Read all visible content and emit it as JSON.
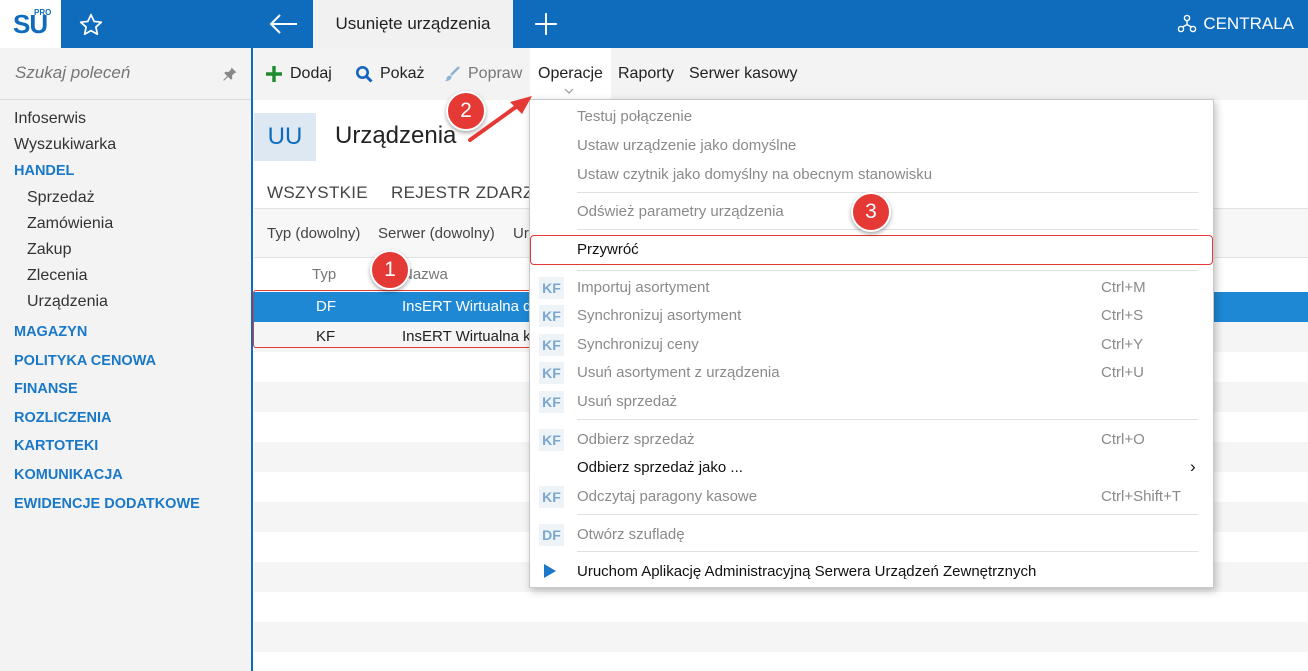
{
  "topbar": {
    "logo_text": "SU",
    "logo_pro": "PRO",
    "active_tab": "Usunięte urządzenia",
    "centrala": "CENTRALA",
    "accent_color": "#0f6cbd",
    "icons": [
      "star-icon",
      "back-arrow-icon",
      "plus-icon",
      "network-icon"
    ]
  },
  "sidebar": {
    "search_placeholder": "Szukaj poleceń",
    "items": [
      "Infoserwis",
      "Wyszukiwarka"
    ],
    "handel": {
      "label": "HANDEL",
      "children": [
        "Sprzedaż",
        "Zamówienia",
        "Zakup",
        "Zlecenia",
        "Urządzenia"
      ]
    },
    "sections": [
      "MAGAZYN",
      "POLITYKA CENOWA",
      "FINANSE",
      "ROZLICZENIA",
      "KARTOTEKI",
      "KOMUNIKACJA",
      "EWIDENCJE DODATKOWE"
    ]
  },
  "toolbar": {
    "add": "Dodaj",
    "show": "Pokaż",
    "edit": "Popraw",
    "operations": "Operacje",
    "reports": "Raporty",
    "cash_server": "Serwer kasowy"
  },
  "main": {
    "badge": "UU",
    "title": "Urządzenia",
    "subtabs": [
      "WSZYSTKIE",
      "REJESTR ZDARZE"
    ],
    "filters": [
      "Typ (dowolny)",
      "Serwer (dowolny)",
      "Ur"
    ],
    "columns": {
      "type": "Typ",
      "name": "Nazwa"
    },
    "rows": [
      {
        "type": "DF",
        "name": "InsERT Wirtualna d"
      },
      {
        "type": "KF",
        "name": "InsERT Wirtualna k"
      }
    ]
  },
  "menu": {
    "items": [
      {
        "label": "Testuj połączenie"
      },
      {
        "label": "Ustaw urządzenie jako domyślne"
      },
      {
        "label": "Ustaw czytnik jako domyślny na obecnym stanowisku"
      },
      {
        "label": "Odśwież parametry urządzenia"
      },
      {
        "label": "Przywróć"
      },
      {
        "badge": "KF",
        "label": "Importuj asortyment",
        "shortcut": "Ctrl+M"
      },
      {
        "badge": "KF",
        "label": "Synchronizuj asortyment",
        "shortcut": "Ctrl+S"
      },
      {
        "badge": "KF",
        "label": "Synchronizuj ceny",
        "shortcut": "Ctrl+Y"
      },
      {
        "badge": "KF",
        "label": "Usuń asortyment z urządzenia",
        "shortcut": "Ctrl+U"
      },
      {
        "badge": "KF",
        "label": "Usuń sprzedaż"
      },
      {
        "badge": "KF",
        "label": "Odbierz sprzedaż",
        "shortcut": "Ctrl+O"
      },
      {
        "label": "Odbierz sprzedaż jako ...",
        "arrow": "›"
      },
      {
        "badge": "KF",
        "label": "Odczytaj paragony kasowe",
        "shortcut": "Ctrl+Shift+T"
      },
      {
        "badge": "DF",
        "label": "Otwórz szufladę"
      },
      {
        "label": "Uruchom Aplikację Administracyjną Serwera Urządzeń Zewnętrznych"
      }
    ]
  },
  "annotations": {
    "step1": "1",
    "step2": "2",
    "step3": "3",
    "color": "#e53935"
  }
}
